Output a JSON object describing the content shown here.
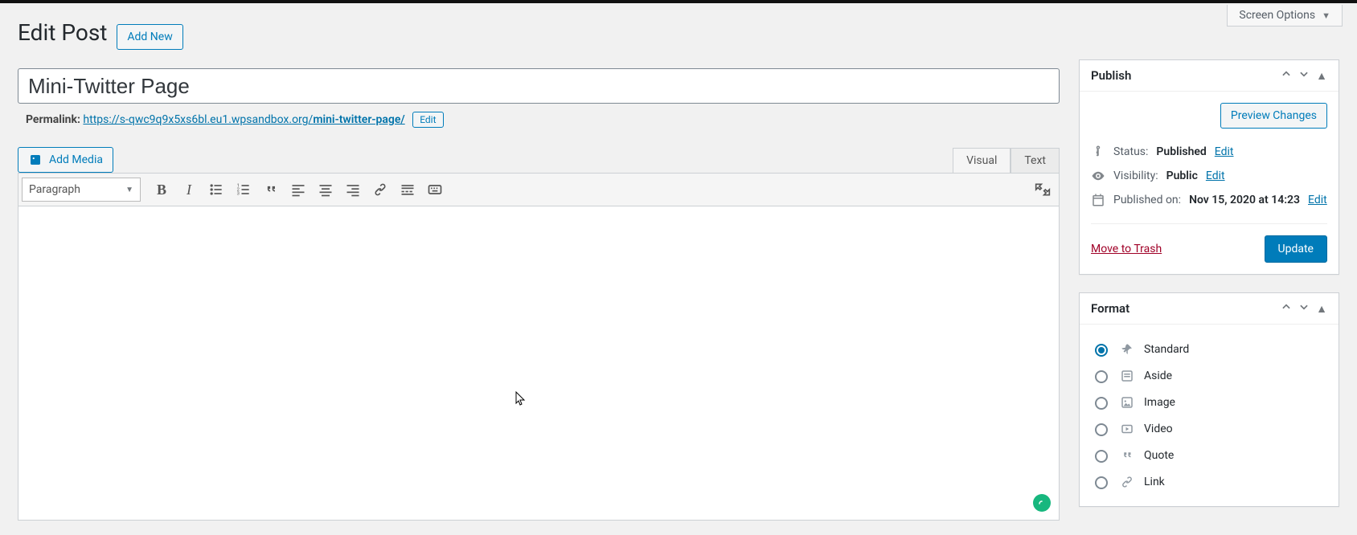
{
  "screen_options": "Screen Options",
  "page_heading": "Edit Post",
  "add_new": "Add New",
  "title_value": "Mini-Twitter Page",
  "permalink_label": "Permalink:",
  "permalink_base": "https://s-qwc9q9x5xs6bl.eu1.wpsandbox.org/",
  "permalink_slug": "mini-twitter-page/",
  "permalink_edit": "Edit",
  "add_media": "Add Media",
  "tabs": {
    "visual": "Visual",
    "text": "Text"
  },
  "toolbar_format": "Paragraph",
  "publish": {
    "title": "Publish",
    "preview": "Preview Changes",
    "status_label": "Status:",
    "status_value": "Published",
    "visibility_label": "Visibility:",
    "visibility_value": "Public",
    "published_label": "Published on:",
    "published_value": "Nov 15, 2020 at 14:23",
    "edit": "Edit",
    "trash": "Move to Trash",
    "update": "Update"
  },
  "format": {
    "title": "Format",
    "options": {
      "standard": "Standard",
      "aside": "Aside",
      "image": "Image",
      "video": "Video",
      "quote": "Quote",
      "link": "Link"
    }
  }
}
